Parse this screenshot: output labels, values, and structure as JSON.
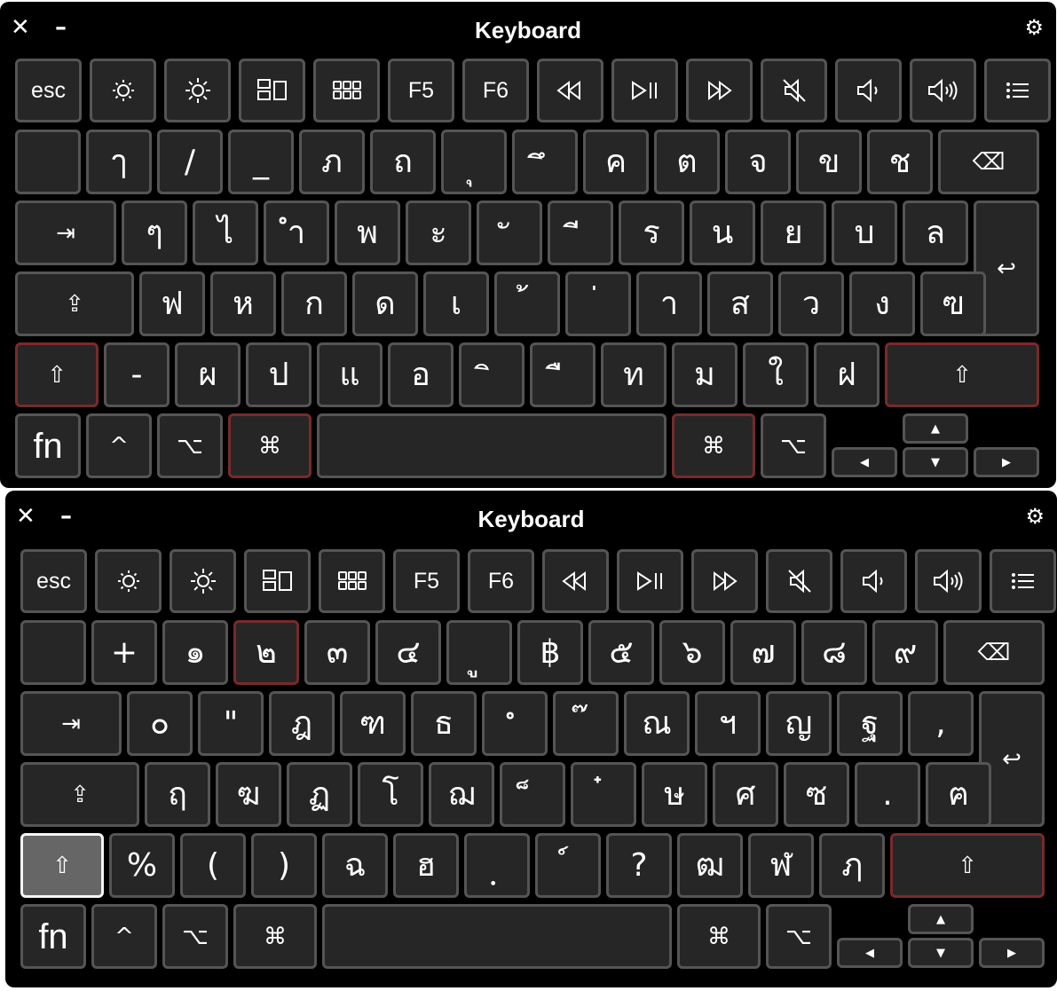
{
  "keyboards": [
    {
      "title": "Keyboard",
      "close_label": "✕",
      "minimize_label": "–",
      "settings_icon": "gear-icon",
      "rows": {
        "function": [
          {
            "label": "esc",
            "type": "text"
          },
          {
            "icon": "brightness-down-icon"
          },
          {
            "icon": "brightness-up-icon"
          },
          {
            "icon": "mission-control-icon"
          },
          {
            "icon": "launchpad-icon"
          },
          {
            "label": "F5",
            "type": "text"
          },
          {
            "label": "F6",
            "type": "text"
          },
          {
            "icon": "rewind-icon"
          },
          {
            "icon": "play-pause-icon"
          },
          {
            "icon": "fast-forward-icon"
          },
          {
            "icon": "mute-icon"
          },
          {
            "icon": "volume-down-icon"
          },
          {
            "icon": "volume-up-icon"
          },
          {
            "icon": "list-icon"
          }
        ],
        "number": [
          "",
          "ๅ",
          "/",
          "_",
          "ภ",
          "ถ",
          "ุ",
          "ึ",
          "ค",
          "ต",
          "จ",
          "ข",
          "ช"
        ],
        "top": [
          "ๆ",
          "ไ",
          "ำ",
          "พ",
          "ะ",
          "ั",
          "ี",
          "ร",
          "น",
          "ย",
          "บ",
          "ล"
        ],
        "home": [
          "ฟ",
          "ห",
          "ก",
          "ด",
          "เ",
          "้",
          "่",
          "า",
          "ส",
          "ว",
          "ง",
          "ฃ"
        ],
        "bottom": [
          "-",
          "ผ",
          "ป",
          "แ",
          "อ",
          "ิ",
          "ื",
          "ท",
          "ม",
          "ใ",
          "ฝ"
        ]
      },
      "modifiers": {
        "fn": "fn",
        "control": "^",
        "option": "⌥",
        "command": "⌘",
        "tab": "⇥",
        "return": "↩",
        "shift": "⇧",
        "capslock": "⇪",
        "delete": "⌫",
        "arrow_up": "▲",
        "arrow_down": "▼",
        "arrow_left": "◀",
        "arrow_right": "▶"
      },
      "highlighted_keys": [
        "left-shift",
        "right-shift",
        "left-command",
        "right-command"
      ],
      "pressed_keys": []
    },
    {
      "title": "Keyboard",
      "close_label": "✕",
      "minimize_label": "–",
      "settings_icon": "gear-icon",
      "rows": {
        "function": [
          {
            "label": "esc",
            "type": "text"
          },
          {
            "icon": "brightness-down-icon"
          },
          {
            "icon": "brightness-up-icon"
          },
          {
            "icon": "mission-control-icon"
          },
          {
            "icon": "launchpad-icon"
          },
          {
            "label": "F5",
            "type": "text"
          },
          {
            "label": "F6",
            "type": "text"
          },
          {
            "icon": "rewind-icon"
          },
          {
            "icon": "play-pause-icon"
          },
          {
            "icon": "fast-forward-icon"
          },
          {
            "icon": "mute-icon"
          },
          {
            "icon": "volume-down-icon"
          },
          {
            "icon": "volume-up-icon"
          },
          {
            "icon": "list-icon"
          }
        ],
        "number": [
          "",
          "+",
          "๑",
          "๒",
          "๓",
          "๔",
          "ู",
          "฿",
          "๕",
          "๖",
          "๗",
          "๘",
          "๙"
        ],
        "top": [
          "๐",
          "\"",
          "ฎ",
          "ฑ",
          "ธ",
          "ํ",
          "๊",
          "ณ",
          "ฯ",
          "ญ",
          "ฐ",
          ","
        ],
        "home": [
          "ฤ",
          "ฆ",
          "ฏ",
          "โ",
          "ฌ",
          "็",
          "๋",
          "ษ",
          "ศ",
          "ซ",
          ".",
          "ฅ"
        ],
        "bottom": [
          "%",
          "(",
          ")",
          "ฉ",
          "ฮ",
          "ฺ",
          "์",
          "?",
          "ฒ",
          "ฬ",
          "ฦ"
        ]
      },
      "modifiers": {
        "fn": "fn",
        "control": "^",
        "option": "⌥",
        "command": "⌘",
        "tab": "⇥",
        "return": "↩",
        "shift": "⇧",
        "capslock": "⇪",
        "delete": "⌫",
        "arrow_up": "▲",
        "arrow_down": "▼",
        "arrow_left": "◀",
        "arrow_right": "▶"
      },
      "highlighted_keys": [
        "number-key-3",
        "right-shift"
      ],
      "pressed_keys": [
        "left-shift"
      ]
    }
  ]
}
